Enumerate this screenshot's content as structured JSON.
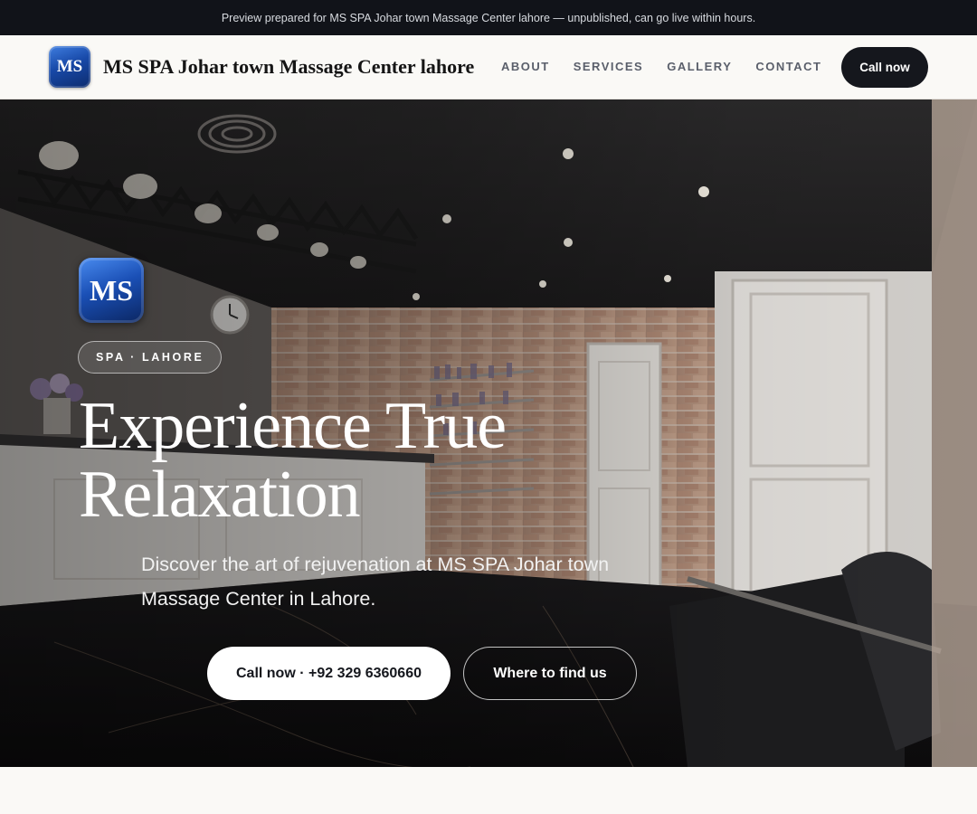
{
  "preview_banner": {
    "text": "Preview prepared for MS SPA Johar town Massage Center lahore — unpublished, can go live within hours."
  },
  "header": {
    "logo_text": "MS",
    "brand_name": "MS SPA Johar town Massage Center lahore",
    "nav": [
      {
        "label": "ABOUT"
      },
      {
        "label": "SERVICES"
      },
      {
        "label": "GALLERY"
      },
      {
        "label": "CONTACT"
      }
    ],
    "call_label": "Call now"
  },
  "hero": {
    "logo_text": "MS",
    "eyebrow": "SPA · LAHORE",
    "title": "Experience True Relaxation",
    "subtitle": "Discover the art of rejuvenation at MS SPA Johar town Massage Center in Lahore.",
    "primary_cta": "Call now · +92 329 6360660",
    "secondary_cta": "Where to find us"
  },
  "colors": {
    "banner_bg": "#111319",
    "header_bg": "#faf9f6",
    "dark_button": "#15171d",
    "logo_blue": "#1849a8"
  }
}
